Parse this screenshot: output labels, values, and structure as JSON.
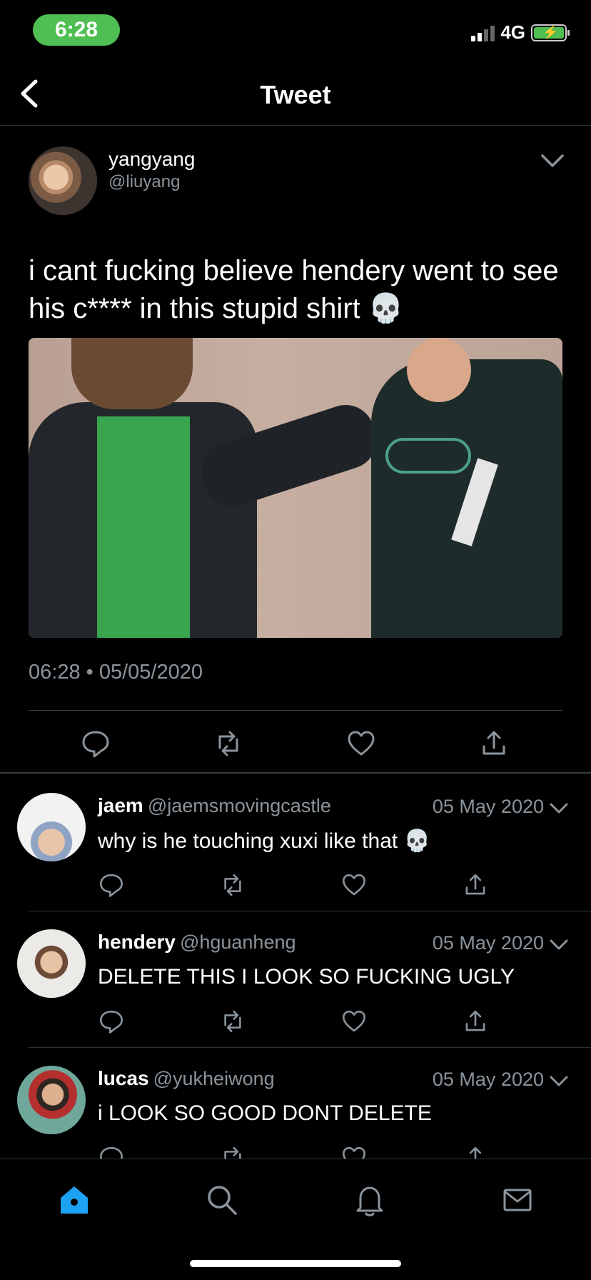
{
  "status_bar": {
    "time": "6:28",
    "network": "4G"
  },
  "header": {
    "title": "Tweet"
  },
  "tweet": {
    "author_name": "yangyang",
    "author_handle": "@liuyang",
    "text": "i cant fucking believe hendery went to see his c**** in this stupid shirt 💀",
    "timestamp": "06:28 • 05/05/2020"
  },
  "replies": [
    {
      "name": "jaem",
      "handle": "@jaemsmovingcastle",
      "date": "05 May 2020",
      "text": "why is he touching xuxi like that 💀"
    },
    {
      "name": "hendery",
      "handle": "@hguanheng",
      "date": "05 May 2020",
      "text": "DELETE THIS I LOOK SO FUCKING UGLY"
    },
    {
      "name": "lucas",
      "handle": "@yukheiwong",
      "date": "05 May 2020",
      "text": "i LOOK SO GOOD DONT DELETE"
    }
  ],
  "icons": {
    "back": "chevron-left-icon",
    "more": "chevron-down-icon",
    "reply": "reply-icon",
    "retweet": "retweet-icon",
    "like": "heart-icon",
    "share": "share-icon",
    "tabs": [
      "home-icon",
      "search-icon",
      "bell-icon",
      "mail-icon"
    ]
  },
  "colors": {
    "accent": "#1da1f2",
    "status_pill": "#4fbf53",
    "muted_text": "#8b949b"
  }
}
